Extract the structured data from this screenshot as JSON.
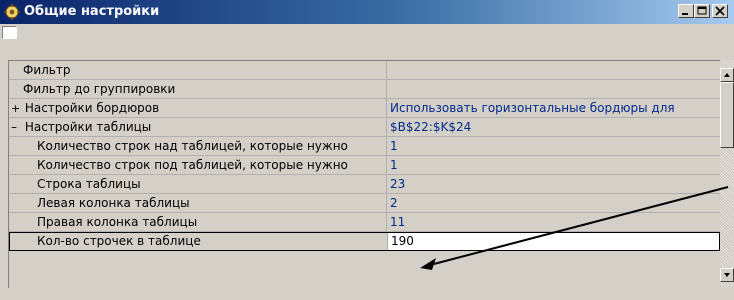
{
  "window": {
    "title": "Общие настройки",
    "minimize_glyph": "_",
    "maximize_glyph": "□",
    "close_glyph": "×"
  },
  "properties": [
    {
      "name": "Фильтр",
      "value": "",
      "marker": "",
      "indent": 1
    },
    {
      "name": "Фильтр до группировки",
      "value": "",
      "marker": "",
      "indent": 1
    },
    {
      "name": "Настройки бордюров",
      "value": "Использовать горизонтальные бордюры для",
      "marker": "+",
      "indent": 0
    },
    {
      "name": "Настройки таблицы",
      "value": "$B$22:$K$24",
      "marker": "–",
      "indent": 0
    },
    {
      "name": "Количество строк над таблицей, которые нужно",
      "value": "1",
      "marker": "",
      "indent": 2
    },
    {
      "name": "Количество строк под таблицей, которые нужно",
      "value": "1",
      "marker": "",
      "indent": 2
    },
    {
      "name": "Строка таблицы",
      "value": "23",
      "marker": "",
      "indent": 2
    },
    {
      "name": "Левая колонка таблицы",
      "value": "2",
      "marker": "",
      "indent": 2
    },
    {
      "name": "Правая колонка таблицы",
      "value": "11",
      "marker": "",
      "indent": 2
    },
    {
      "name": "Кол-во строчек в таблице",
      "value": "190",
      "marker": "",
      "indent": 2
    }
  ],
  "colors": {
    "titlebar_start": "#0a246a",
    "titlebar_end": "#a6caf0",
    "value_text": "#002a8c",
    "face": "#d4d0c8"
  },
  "icons": {
    "title": "settings-app-icon",
    "scroll_up": "up-arrow-icon",
    "scroll_down": "down-arrow-icon",
    "annotation": "pointer-arrow-icon"
  }
}
